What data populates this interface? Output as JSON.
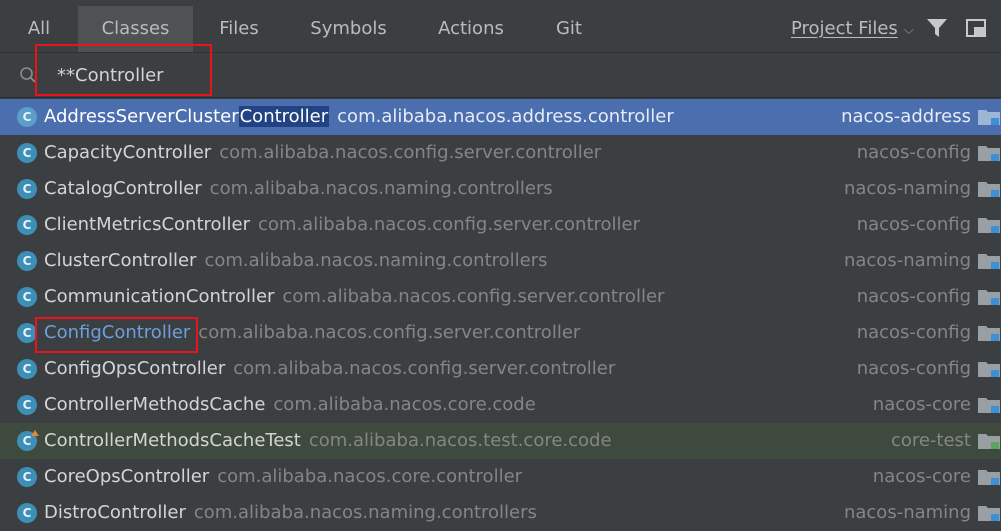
{
  "tabs": [
    {
      "label": "All",
      "active": false
    },
    {
      "label": "Classes",
      "active": true
    },
    {
      "label": "Files",
      "active": false
    },
    {
      "label": "Symbols",
      "active": false
    },
    {
      "label": "Actions",
      "active": false
    },
    {
      "label": "Git",
      "active": false
    }
  ],
  "scope": {
    "label": "Project Files",
    "icon": "chevron-down-icon"
  },
  "toolbar_icons": [
    "filter-icon",
    "pin-window-icon"
  ],
  "search": {
    "value": "**Controller",
    "icon": "search-icon"
  },
  "results": [
    {
      "name_pre": "AddressServerCluster",
      "name_hl": "Controller",
      "name_post": "",
      "package": "com.alibaba.nacos.address.controller",
      "module": "nacos-address",
      "selected": true
    },
    {
      "name": "CapacityController",
      "package": "com.alibaba.nacos.config.server.controller",
      "module": "nacos-config"
    },
    {
      "name": "CatalogController",
      "package": "com.alibaba.nacos.naming.controllers",
      "module": "nacos-naming"
    },
    {
      "name": "ClientMetricsController",
      "package": "com.alibaba.nacos.config.server.controller",
      "module": "nacos-config"
    },
    {
      "name": "ClusterController",
      "package": "com.alibaba.nacos.naming.controllers",
      "module": "nacos-naming"
    },
    {
      "name": "CommunicationController",
      "package": "com.alibaba.nacos.config.server.controller",
      "module": "nacos-config"
    },
    {
      "name": "ConfigController",
      "package": "com.alibaba.nacos.config.server.controller",
      "module": "nacos-config",
      "link": true
    },
    {
      "name": "ConfigOpsController",
      "package": "com.alibaba.nacos.config.server.controller",
      "module": "nacos-config"
    },
    {
      "name": "ControllerMethodsCache",
      "package": "com.alibaba.nacos.core.code",
      "module": "nacos-core"
    },
    {
      "name": "ControllerMethodsCacheTest",
      "package": "com.alibaba.nacos.test.core.code",
      "module": "core-test",
      "test": true
    },
    {
      "name": "CoreOpsController",
      "package": "com.alibaba.nacos.core.controller",
      "module": "nacos-core"
    },
    {
      "name": "DistroController",
      "package": "com.alibaba.nacos.naming.controllers",
      "module": "nacos-naming"
    }
  ],
  "colors": {
    "background": "#3c3f41",
    "selection": "#4b6eaf",
    "match_highlight": "#214283",
    "class_icon": "#3d8fb7",
    "annotation_box": "#e8141b",
    "test_row": "#3f4a3e"
  }
}
